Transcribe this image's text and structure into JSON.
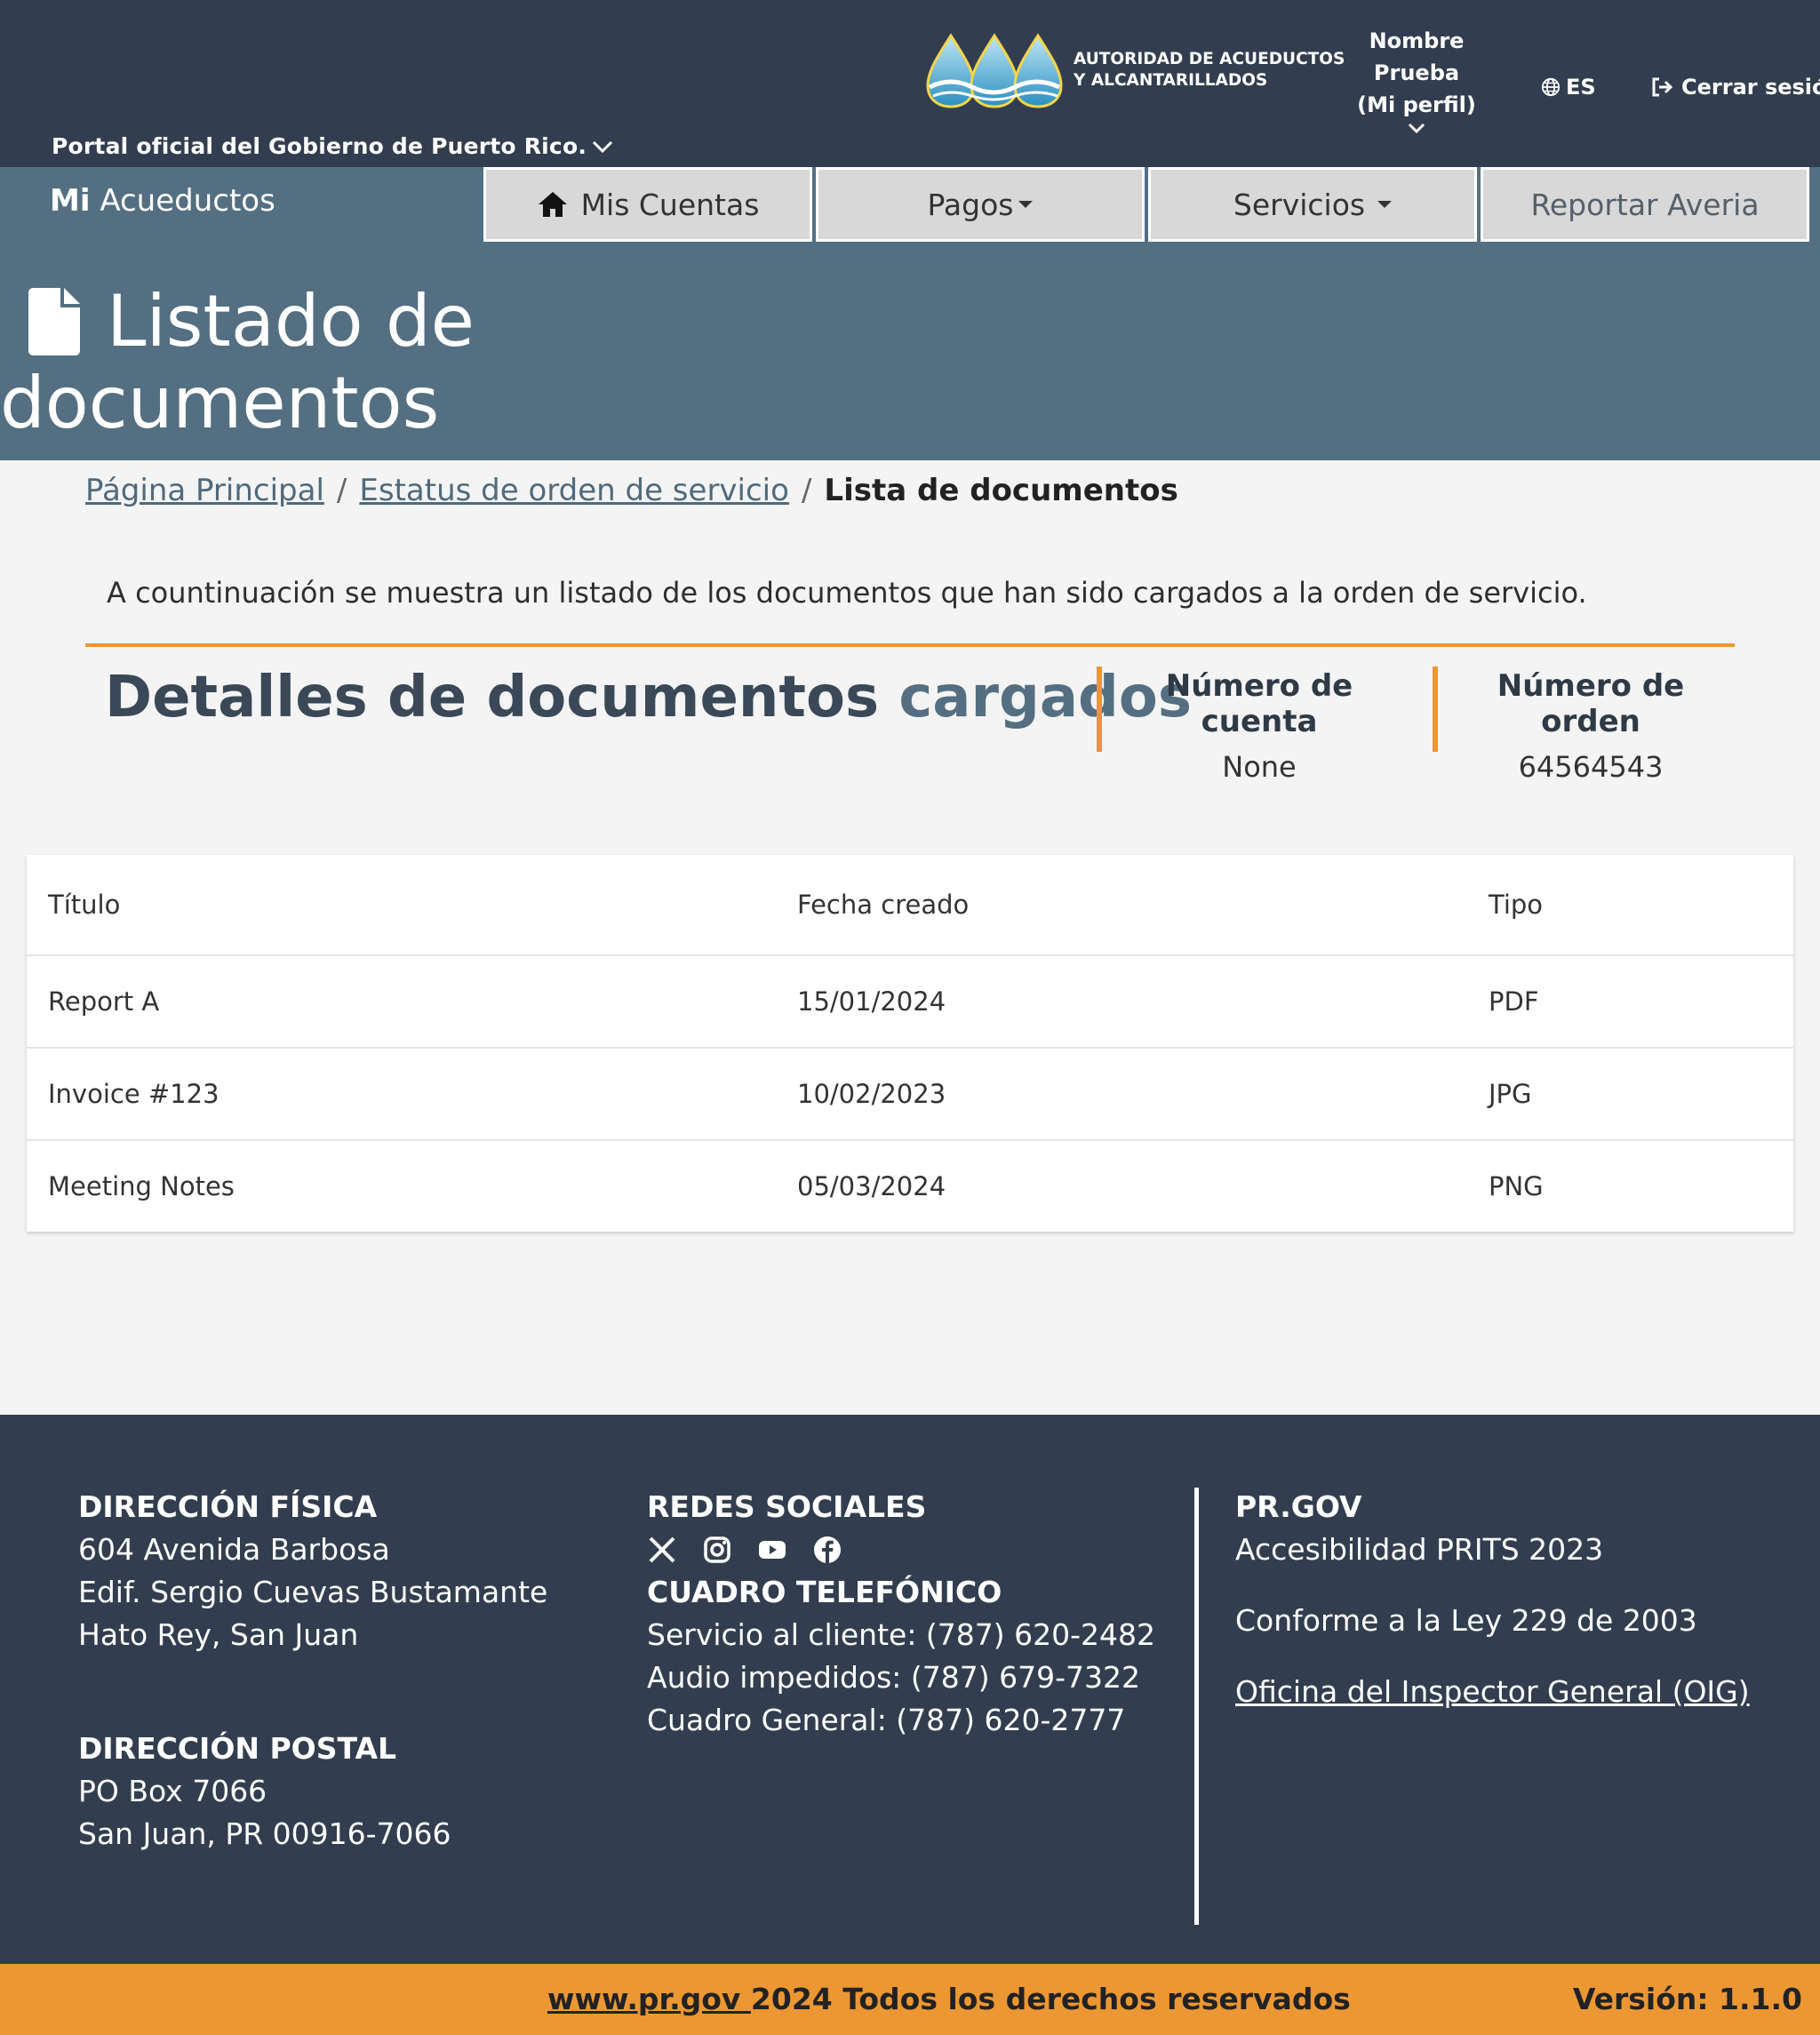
{
  "header": {
    "gov_portal": "Portal oficial del Gobierno de Puerto Rico.",
    "logo_line1": "AUTORIDAD DE ACUEDUCTOS",
    "logo_line2": "Y ALCANTARILLADOS",
    "profile_line1": "Nombre",
    "profile_line2": "Prueba",
    "profile_line3": "(Mi perfil)",
    "language": "ES",
    "logout": "Cerrar sesión"
  },
  "nav": {
    "brand_bold": "Mi",
    "brand_rest": "Acueductos",
    "tabs": [
      {
        "label": "Mis Cuentas",
        "icon": "home-icon"
      },
      {
        "label": "Pagos",
        "icon": "caret-down-icon"
      },
      {
        "label": "Servicios",
        "icon": "caret-down-icon"
      },
      {
        "label": "Reportar Averia"
      }
    ]
  },
  "page": {
    "title_line1": "Listado de",
    "title_line2": "documentos",
    "title_icon": "file-icon"
  },
  "breadcrumb": {
    "items": [
      "Página Principal",
      "Estatus de orden de servicio"
    ],
    "current": "Lista de documentos"
  },
  "content": {
    "intro": "A countinuación se muestra un listado de los documentos que han sido cargados a la orden de servicio.",
    "details_title_plain": "Detalles de documentos",
    "details_title_bold": "cargados",
    "account_label": "Número de cuenta",
    "account_value": "None",
    "order_label": "Número de orden",
    "order_value": "64564543"
  },
  "table": {
    "headers": [
      "Título",
      "Fecha creado",
      "Tipo"
    ],
    "rows": [
      [
        "Report A",
        "15/01/2024",
        "PDF"
      ],
      [
        "Invoice #123",
        "10/02/2023",
        "JPG"
      ],
      [
        "Meeting Notes",
        "05/03/2024",
        "PNG"
      ]
    ]
  },
  "footer": {
    "physical_title": "DIRECCIÓN FÍSICA",
    "physical_lines": [
      "604 Avenida Barbosa",
      "Edif. Sergio Cuevas Bustamante",
      "Hato Rey, San Juan"
    ],
    "postal_title": "DIRECCIÓN POSTAL",
    "postal_lines": [
      "PO Box 7066",
      "San Juan, PR 00916-7066"
    ],
    "social_title": "REDES SOCIALES",
    "social_icons": [
      "x-icon",
      "instagram-icon",
      "youtube-icon",
      "facebook-icon"
    ],
    "phone_title": "CUADRO TELEFÓNICO",
    "phone_lines": [
      "Servicio al cliente: (787) 620-2482",
      "Audio impedidos: (787) 679-7322",
      "Cuadro General: (787) 620-2777"
    ],
    "prgov_title": "PR.GOV",
    "prgov_lines": [
      "Accesibilidad PRITS 2023",
      "Conforme a la Ley 229 de 2003"
    ],
    "prgov_link": "Oficina del Inspector General (OIG)",
    "copyright_link": "www.pr.gov ",
    "copyright_text": "2024 Todos los derechos reservados",
    "version": "Versión: 1.1.0"
  },
  "colors": {
    "topbar": "#323e4f",
    "band": "#546f82",
    "accent": "#ec9733"
  }
}
